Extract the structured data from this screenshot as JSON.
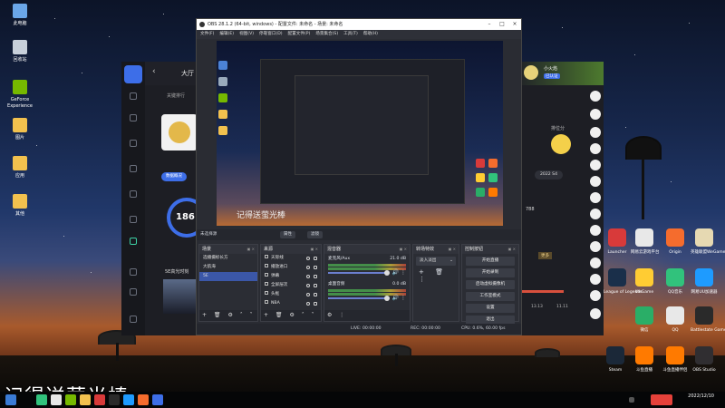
{
  "desktop": {
    "icons": [
      {
        "label": "此电脑",
        "icon": "computer-icon",
        "color": "#6aa6e8"
      },
      {
        "label": "回收站",
        "icon": "recycle-bin-icon",
        "color": "#c8d0da"
      },
      {
        "label": "GeForce Experience",
        "icon": "nvidia-icon",
        "color": "#76b900"
      },
      {
        "label": "图片",
        "icon": "folder-icon",
        "color": "#f2c14e"
      },
      {
        "label": "应用",
        "icon": "folder-icon",
        "color": "#f2c14e"
      },
      {
        "label": "其他",
        "icon": "folder-icon",
        "color": "#f2c14e"
      }
    ],
    "apps": [
      {
        "label": "Launcher",
        "icon": "launcher-icon",
        "color": "#d83a3a"
      },
      {
        "label": "网易云游戏平台",
        "icon": "netease-icon",
        "color": "#e8e8e8"
      },
      {
        "label": "Origin",
        "icon": "origin-icon",
        "color": "#f56c2d"
      },
      {
        "label": "英雄联盟WeGame",
        "icon": "wegame-icon",
        "color": "#e6d9b2"
      },
      {
        "label": "League of Legends",
        "icon": "lol-icon",
        "color": "#1a2f4a"
      },
      {
        "label": "WeGame",
        "icon": "wegame-icon",
        "color": "#ffcc33"
      },
      {
        "label": "QQ音乐",
        "icon": "qq-music-icon",
        "color": "#31c27c"
      },
      {
        "label": "网易UU加速器",
        "icon": "uu-icon",
        "color": "#1e9bff"
      },
      {
        "label": "微信",
        "icon": "wechat-icon",
        "color": "#2aae67"
      },
      {
        "label": "QQ",
        "icon": "qq-icon",
        "color": "#e8e8e8"
      },
      {
        "label": "Battlestate Games",
        "icon": "battlestate-icon",
        "color": "#2a2a2a"
      },
      {
        "label": "Steam",
        "icon": "steam-icon",
        "color": "#1b2838"
      },
      {
        "label": "斗鱼直播",
        "icon": "douyu-icon",
        "color": "#ff7a00"
      },
      {
        "label": "斗鱼直播伴侣",
        "icon": "douyu-companion-icon",
        "color": "#ff7a00"
      },
      {
        "label": "OBS Studio",
        "icon": "obs-icon",
        "color": "#302e31"
      }
    ]
  },
  "background_app": {
    "title": "大厅",
    "left_label": "关键排行",
    "button_label": "数据概况",
    "score": "186",
    "fragment_label": "5E高光时刻",
    "right_title": "小火焰",
    "right_badge": "已认证",
    "right_label": "排位分",
    "year_select": "2022 S4",
    "value_1": "788",
    "value_2": "13.13",
    "value_3": "11.11",
    "tag": "更多"
  },
  "obs": {
    "title": "OBS 28.1.2 (64-bit, windows) - 配置文件: 未命名 - 场景: 未命名",
    "menu": [
      "文件(F)",
      "编辑(E)",
      "视图(V)",
      "停靠窗口(D)",
      "配置文件(P)",
      "场景集合(S)",
      "工具(T)",
      "帮助(H)"
    ],
    "toolbar": {
      "no_source": "未选择源",
      "properties": "属性",
      "filters": "滤镜"
    },
    "preview_overlay": "记得送萤光棒",
    "scenes": {
      "header": "场景",
      "items": [
        "选播摄标长方",
        "大航海",
        "5E"
      ],
      "selected": 2
    },
    "sources": {
      "header": "来源",
      "items": [
        "天际线",
        "播放进口",
        "弹幕",
        "全屏层次",
        "头框",
        "NBA"
      ]
    },
    "mixer": {
      "header": "混音器",
      "channels": [
        {
          "name": "麦克风/Aux",
          "db": "21.0 dB"
        },
        {
          "name": "桌面音频",
          "db": "0.0 dB"
        }
      ]
    },
    "transitions": {
      "header": "转场特效",
      "value": "淡入淡出"
    },
    "controls": {
      "header": "控制按钮",
      "buttons": [
        "开始直播",
        "开始录制",
        "启动虚拟摄像机",
        "工作室模式",
        "设置",
        "退出"
      ]
    },
    "status": {
      "live": "LIVE: 00:00:00",
      "rec": "REC: 00:00:00",
      "cpu": "CPU: 0.6%, 60.00 fps"
    },
    "footer_symbols": "+ 🗑 ⚙ ˄ ˅"
  },
  "caption": "记得送萤光棒",
  "clock": {
    "date": "2022/12/10"
  }
}
